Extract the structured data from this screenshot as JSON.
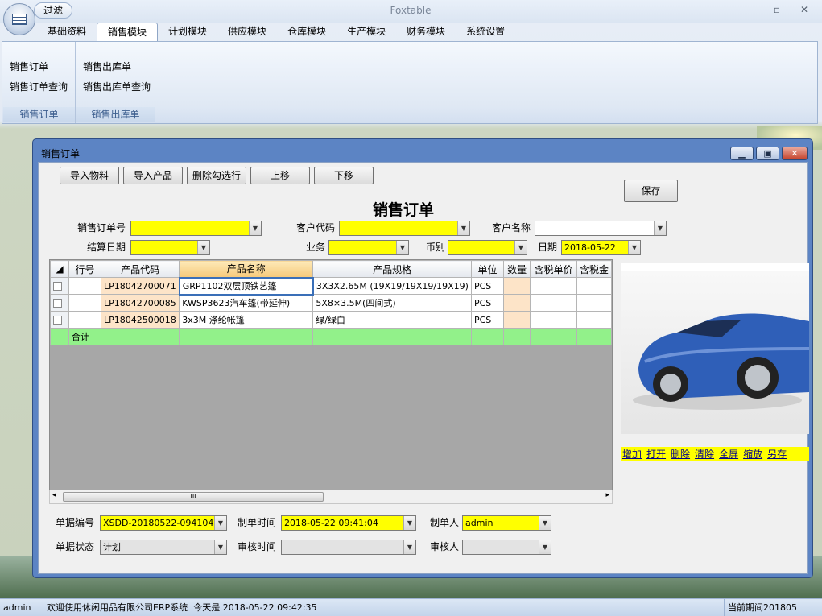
{
  "app": {
    "title": "Foxtable",
    "qat_label": "过滤"
  },
  "ribbon": {
    "tabs": [
      "基础资料",
      "销售模块",
      "计划模块",
      "供应模块",
      "仓库模块",
      "生产模块",
      "财务模块",
      "系统设置"
    ],
    "active_tab": "销售模块",
    "groups": [
      {
        "label": "销售订单",
        "buttons": [
          "销售订单",
          "销售订单查询"
        ]
      },
      {
        "label": "销售出库单",
        "buttons": [
          "销售出库单",
          "销售出库单查询"
        ]
      }
    ]
  },
  "window": {
    "title": "销售订单",
    "form_title": "销售订单",
    "toolbar": [
      "导入物料",
      "导入产品",
      "删除勾选行",
      "上移",
      "下移"
    ],
    "save_label": "保存",
    "fields": {
      "order_no_label": "销售订单号",
      "order_no": "",
      "customer_code_label": "客户代码",
      "customer_code": "",
      "customer_name_label": "客户名称",
      "customer_name": "",
      "settle_date_label": "结算日期",
      "settle_date": "",
      "business_label": "业务",
      "business": "",
      "currency_label": "币别",
      "currency": "",
      "date_label": "日期",
      "date": "2018-05-22"
    },
    "grid": {
      "columns": [
        "行号",
        "产品代码",
        "产品名称",
        "产品规格",
        "单位",
        "数量",
        "含税单价",
        "含税金"
      ],
      "rows": [
        {
          "line": "",
          "code": "LP18042700071",
          "name": "GRP1102双层顶铁艺篷",
          "spec": "3X3X2.65M (19X19/19X19/19X19)",
          "unit": "PCS",
          "qty": "",
          "price": "",
          "amount": ""
        },
        {
          "line": "",
          "code": "LP18042700085",
          "name": "KWSP3623汽车篷(带延伸)",
          "spec": "5X8×3.5M(四间式)",
          "unit": "PCS",
          "qty": "",
          "price": "",
          "amount": ""
        },
        {
          "line": "",
          "code": "LP18042500018",
          "name": "3x3M 涤纶帐篷",
          "spec": "绿/绿白",
          "unit": "PCS",
          "qty": "",
          "price": "",
          "amount": ""
        }
      ],
      "total_label": "合计",
      "scroll_thumb": "III"
    },
    "picture_links": [
      "增加",
      "打开",
      "删除",
      "清除",
      "全屏",
      "缩放",
      "另存"
    ],
    "footer": {
      "doc_no_label": "单据编号",
      "doc_no": "XSDD-20180522-094104",
      "created_time_label": "制单时间",
      "created_time": "2018-05-22 09:41:04",
      "creator_label": "制单人",
      "creator": "admin",
      "status_label": "单据状态",
      "status": "计划",
      "review_time_label": "审核时间",
      "review_time": "",
      "reviewer_label": "审核人",
      "reviewer": ""
    }
  },
  "statusbar": {
    "user": "admin",
    "message": "欢迎使用休闲用品有限公司ERP系统  今天是 2018-05-22 09:42:35",
    "period": "当前期间201805"
  }
}
